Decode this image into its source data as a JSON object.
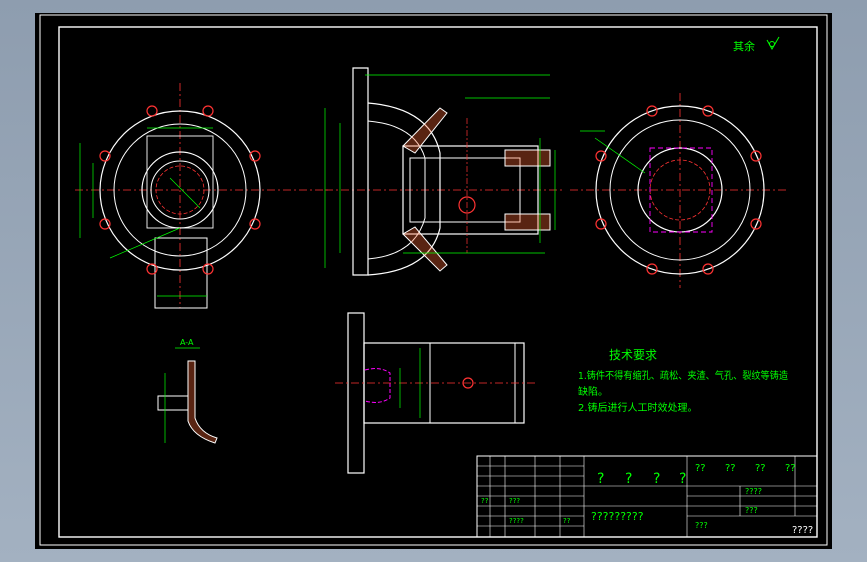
{
  "viewport": {
    "background": "#94a3b4",
    "canvas_color": "#000000"
  },
  "colors": {
    "frame": "#ffffff",
    "geometry": "#ffffff",
    "dimension": "#00ff00",
    "center_line": "#ff3333",
    "hole": "#ff3333",
    "hidden": "#ff00ff",
    "note": "#00ff00",
    "title_block": "#ffffff"
  },
  "roughness": {
    "label": "其余"
  },
  "section": {
    "label": "A-A"
  },
  "tech_notes": {
    "title": "技术要求",
    "line1": "1.铸件不得有缩孔、疏松、夹渣、气孔、裂纹等铸造",
    "line1b": "缺陷。",
    "line2": "2.铸后进行人工时效处理。"
  },
  "title_block": {
    "big_cells": [
      "?",
      "?",
      "?",
      "?"
    ],
    "right_top": [
      "??",
      "??",
      "??",
      "??"
    ],
    "right_rows": [
      "????",
      "???",
      "???"
    ],
    "left_rows": [
      "??",
      "???",
      "????",
      "??"
    ],
    "bottom_text": "?????????",
    "corner_text": "????"
  },
  "icons": {
    "roughness": "roughness-symbol-icon"
  }
}
